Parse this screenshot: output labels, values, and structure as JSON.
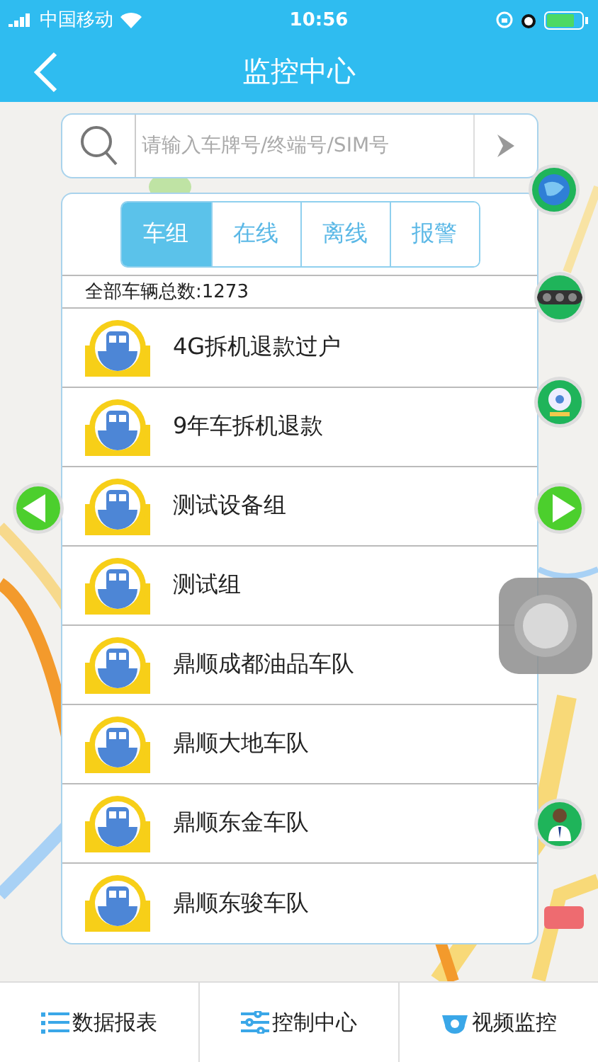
{
  "status_bar": {
    "carrier": "中国移动",
    "time": "10:56"
  },
  "nav_bar": {
    "title": "监控中心"
  },
  "search": {
    "placeholder": "请输入车牌号/终端号/SIM号"
  },
  "tabs": [
    {
      "label": "车组",
      "selected": true
    },
    {
      "label": "在线",
      "selected": false
    },
    {
      "label": "离线",
      "selected": false
    },
    {
      "label": "报警",
      "selected": false
    }
  ],
  "total": "全部车辆总数:1273",
  "groups": [
    "4G拆机退款过户",
    "9年车拆机退款",
    "测试设备组",
    "测试组",
    "鼎顺成都油品车队",
    "鼎顺大地车队",
    "鼎顺东金车队",
    "鼎顺东骏车队"
  ],
  "bottom_bar": [
    {
      "kind": "report",
      "label": "数据报表"
    },
    {
      "kind": "control",
      "label": "控制中心"
    },
    {
      "kind": "video",
      "label": "视频监控"
    }
  ]
}
